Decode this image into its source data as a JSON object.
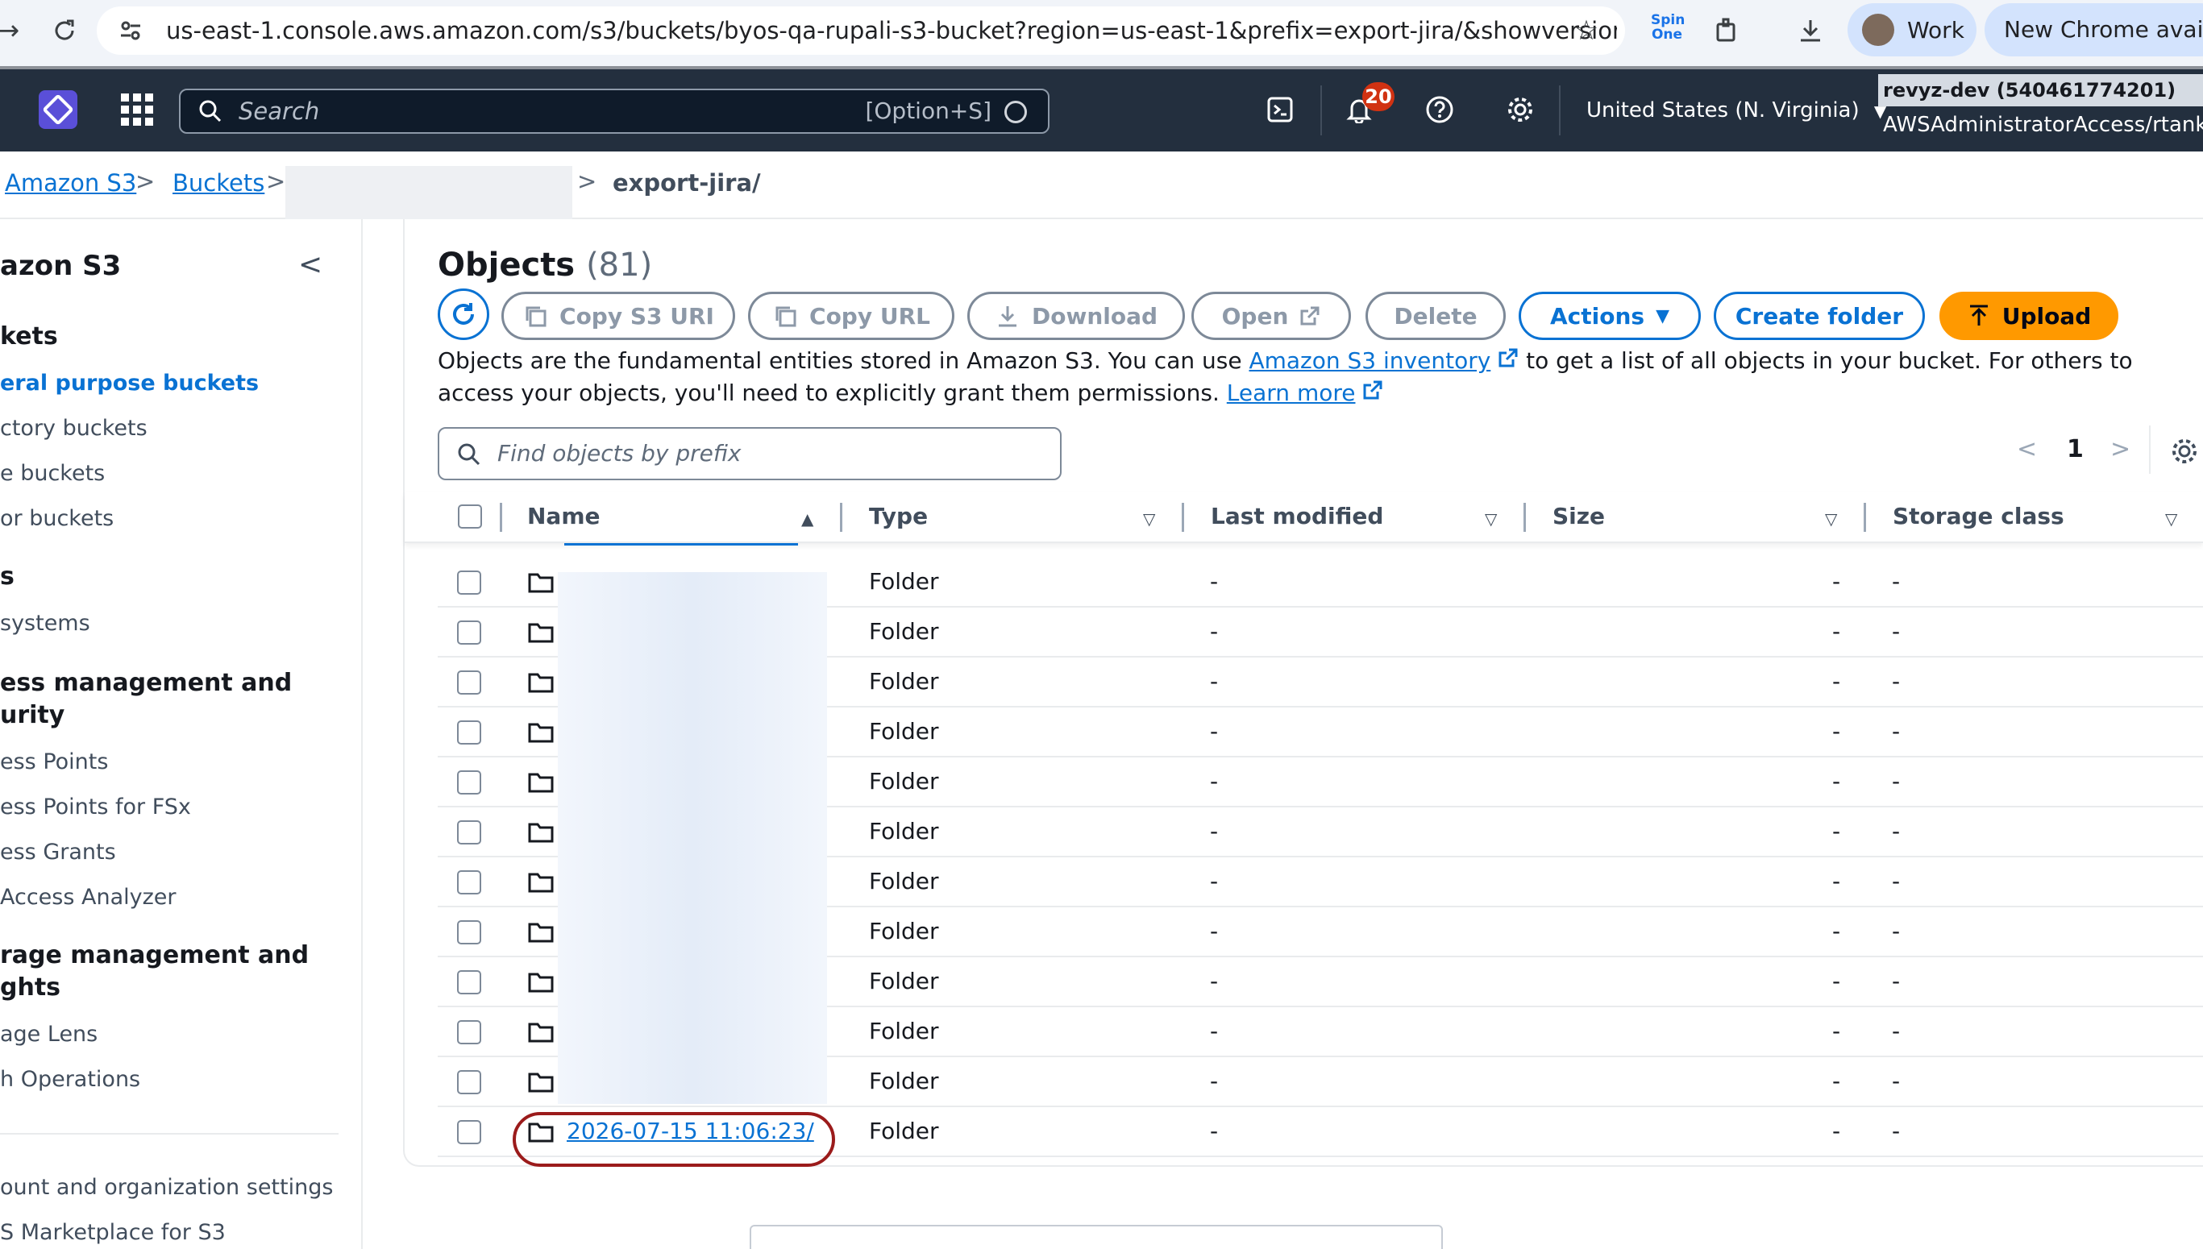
{
  "browser": {
    "url": "us-east-1.console.aws.amazon.com/s3/buckets/byos-qa-rupali-s3-bucket?region=us-east-1&prefix=export-jira/&showversions…",
    "extension_label": "Spin One",
    "profile_label": "Work",
    "new_chrome_label": "New Chrome availab"
  },
  "aws_header": {
    "search_placeholder": "Search",
    "search_shortcut": "[Option+S]",
    "notification_count": "20",
    "region_label": "United States (N. Virginia)",
    "account_name": "revyz-dev (540461774201)",
    "account_role": "AWSAdministratorAccess/rtankar@s"
  },
  "breadcrumb": {
    "items": [
      "Amazon S3",
      "Buckets"
    ],
    "current": "export-jira/"
  },
  "sidebar": {
    "title": "azon S3",
    "sections": [
      {
        "heading": "kets",
        "items": [
          "eral purpose buckets",
          "ctory buckets",
          "e buckets",
          "or buckets"
        ]
      },
      {
        "heading": "s",
        "items": [
          "systems"
        ]
      },
      {
        "heading": "ess management and\nurity",
        "items": [
          "ess Points",
          "ess Points for FSx",
          "ess Grants",
          "Access Analyzer"
        ]
      },
      {
        "heading": "rage management and\nghts",
        "items": [
          "age Lens",
          "h Operations"
        ]
      }
    ],
    "footer_items": [
      "ount and organization settings",
      "S Marketplace for S3"
    ]
  },
  "objects": {
    "title": "Objects",
    "count": "(81)",
    "buttons": {
      "copy_uri": "Copy S3 URI",
      "copy_url": "Copy URL",
      "download": "Download",
      "open": "Open",
      "delete": "Delete",
      "actions": "Actions",
      "create_folder": "Create folder",
      "upload": "Upload"
    },
    "info_text_1": "Objects are the fundamental entities stored in Amazon S3. You can use ",
    "info_link_1": "Amazon S3 inventory",
    "info_text_2": " to get a list of all objects in your bucket. For others to access your objects, you'll need to explicitly grant them permissions. ",
    "info_link_2": "Learn more",
    "find_placeholder": "Find objects by prefix",
    "page": "1"
  },
  "table": {
    "columns": [
      "Name",
      "Type",
      "Last modified",
      "Size",
      "Storage class"
    ],
    "rows": [
      {
        "name": "",
        "type": "Folder",
        "modified": "-",
        "size": "-",
        "storage": "-"
      },
      {
        "name": "",
        "type": "Folder",
        "modified": "-",
        "size": "-",
        "storage": "-"
      },
      {
        "name": "",
        "type": "Folder",
        "modified": "-",
        "size": "-",
        "storage": "-"
      },
      {
        "name": "",
        "type": "Folder",
        "modified": "-",
        "size": "-",
        "storage": "-"
      },
      {
        "name": "",
        "type": "Folder",
        "modified": "-",
        "size": "-",
        "storage": "-"
      },
      {
        "name": "",
        "type": "Folder",
        "modified": "-",
        "size": "-",
        "storage": "-"
      },
      {
        "name": "",
        "type": "Folder",
        "modified": "-",
        "size": "-",
        "storage": "-"
      },
      {
        "name": "",
        "type": "Folder",
        "modified": "-",
        "size": "-",
        "storage": "-"
      },
      {
        "name": "",
        "type": "Folder",
        "modified": "-",
        "size": "-",
        "storage": "-"
      },
      {
        "name": "",
        "type": "Folder",
        "modified": "-",
        "size": "-",
        "storage": "-"
      },
      {
        "name": "",
        "type": "Folder",
        "modified": "-",
        "size": "-",
        "storage": "-"
      },
      {
        "name": "2026-07-15 11:06:23/",
        "type": "Folder",
        "modified": "-",
        "size": "-",
        "storage": "-"
      }
    ]
  },
  "colors": {
    "aws_header": "#232f3e",
    "link": "#0972d3",
    "upload": "#ff9900",
    "highlight_oval": "#9b1b1b"
  }
}
